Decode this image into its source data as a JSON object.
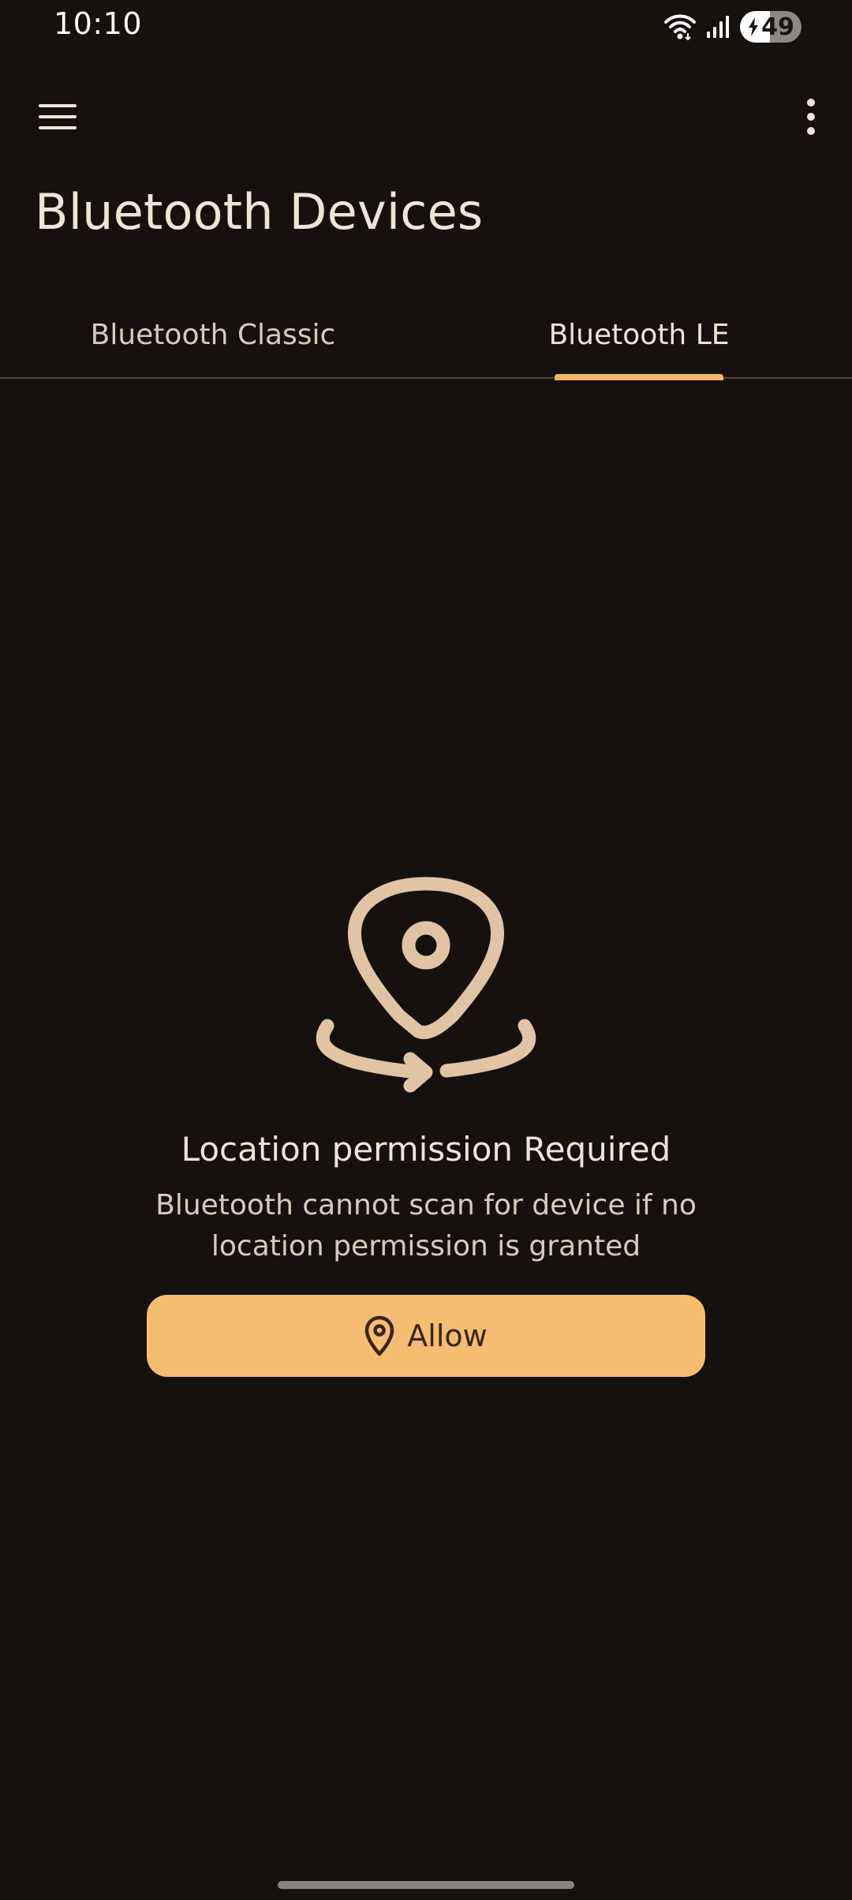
{
  "status_bar": {
    "time": "10:10",
    "battery_level": "49",
    "battery_fraction": 0.49,
    "icons": [
      "wifi-icon",
      "signal-icon",
      "charging-icon"
    ]
  },
  "app_bar": {
    "title": "Bluetooth Devices",
    "menu_icon": "hamburger-menu-icon",
    "more_icon": "more-vert-icon"
  },
  "tabs": [
    {
      "label": "Bluetooth Classic",
      "active": false
    },
    {
      "label": "Bluetooth LE",
      "active": true
    }
  ],
  "empty_state": {
    "icon": "location-permission-icon",
    "title": "Location permission Required",
    "message": "Bluetooth cannot scan for device if no location permission is granted",
    "button": {
      "label": "Allow",
      "icon": "location-pin-icon"
    }
  },
  "colors": {
    "background": "#16110e",
    "accent": "#f4b56a",
    "button": "#f4bd72",
    "icon": "#e1c4a5",
    "text": "#efe4d8"
  }
}
